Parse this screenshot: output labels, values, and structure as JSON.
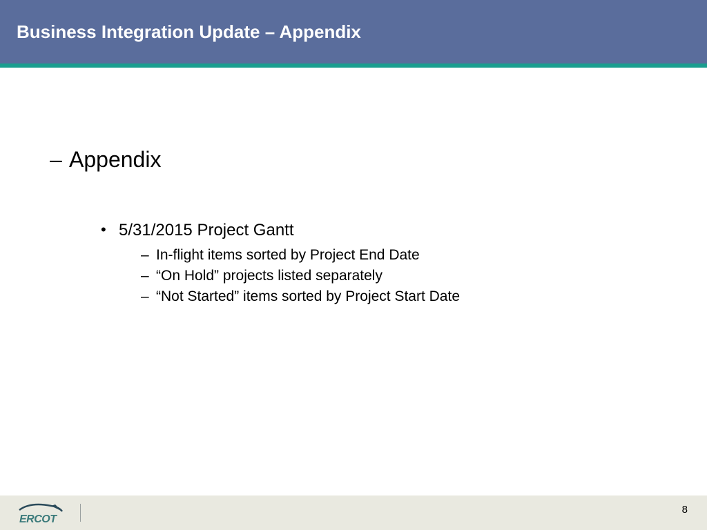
{
  "header": {
    "title": "Business Integration Update – Appendix"
  },
  "main": {
    "section_title": "Appendix",
    "bullet": "5/31/2015 Project Gantt",
    "subs": [
      "In-flight items sorted by Project End Date",
      "“On Hold” projects listed separately",
      "“Not Started” items sorted by Project Start Date"
    ]
  },
  "footer": {
    "logo_text": "ERCOT",
    "page_number": "8"
  }
}
